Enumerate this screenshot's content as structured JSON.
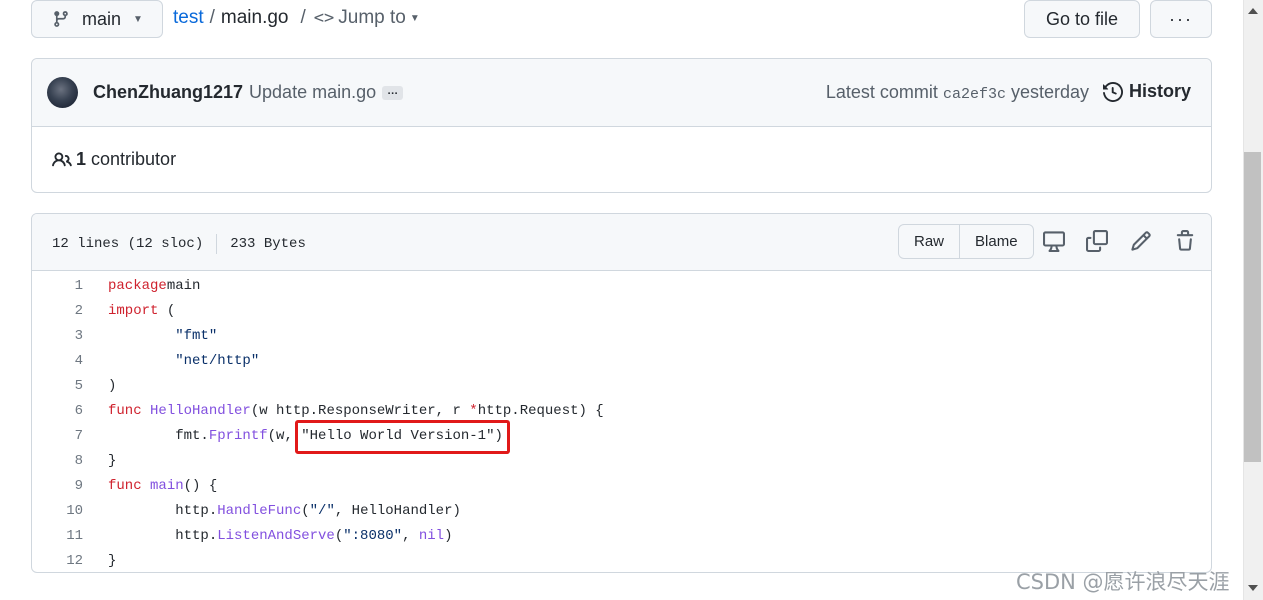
{
  "topbar": {
    "branch": "main",
    "repo": "test",
    "separator": "/",
    "file": "main.go",
    "jump_to": "Jump to",
    "goto_file": "Go to file",
    "more": "···"
  },
  "commit": {
    "author": "ChenZhuang1217",
    "message": "Update main.go",
    "ellipsis": "…",
    "latest_label": "Latest commit",
    "sha": "ca2ef3c",
    "time": "yesterday",
    "history": "History",
    "contributors_count": "1",
    "contributors_label": "contributor"
  },
  "file": {
    "lines_info": "12 lines (12 sloc)",
    "size": "233 Bytes",
    "raw": "Raw",
    "blame": "Blame",
    "code": [
      {
        "n": "1",
        "tokens": [
          [
            "kw",
            "package"
          ],
          [
            "",
            "main"
          ]
        ]
      },
      {
        "n": "2",
        "tokens": [
          [
            "kw",
            "import"
          ],
          [
            "",
            " ("
          ]
        ]
      },
      {
        "n": "3",
        "tokens": [
          [
            "",
            "        "
          ],
          [
            "str",
            "\"fmt\""
          ]
        ]
      },
      {
        "n": "4",
        "tokens": [
          [
            "",
            "        "
          ],
          [
            "str",
            "\"net/http\""
          ]
        ]
      },
      {
        "n": "5",
        "tokens": [
          [
            "",
            ")"
          ]
        ]
      },
      {
        "n": "6",
        "tokens": [
          [
            "kw",
            "func"
          ],
          [
            "",
            " "
          ],
          [
            "fn",
            "HelloHandler"
          ],
          [
            "",
            "(w http.ResponseWriter, r "
          ],
          [
            "kw",
            "*"
          ],
          [
            "",
            "http.Request) {"
          ]
        ]
      },
      {
        "n": "7",
        "tokens": [
          [
            "",
            "        fmt."
          ],
          [
            "fn",
            "Fprintf"
          ],
          [
            "",
            "(w, "
          ],
          [
            "hl",
            "\"Hello World Version-1\")"
          ]
        ]
      },
      {
        "n": "8",
        "tokens": [
          [
            "",
            "}"
          ]
        ]
      },
      {
        "n": "9",
        "tokens": [
          [
            "kw",
            "func"
          ],
          [
            "",
            " "
          ],
          [
            "fn",
            "main"
          ],
          [
            "",
            "() {"
          ]
        ]
      },
      {
        "n": "10",
        "tokens": [
          [
            "",
            "        http."
          ],
          [
            "fn",
            "HandleFunc"
          ],
          [
            "",
            "("
          ],
          [
            "str",
            "\"/\""
          ],
          [
            "",
            ", HelloHandler)"
          ]
        ]
      },
      {
        "n": "11",
        "tokens": [
          [
            "",
            "        http."
          ],
          [
            "fn",
            "ListenAndServe"
          ],
          [
            "",
            "("
          ],
          [
            "str",
            "\":8080\""
          ],
          [
            "",
            ", "
          ],
          [
            "fn",
            "nil"
          ],
          [
            "",
            ")"
          ]
        ]
      },
      {
        "n": "12",
        "tokens": [
          [
            "",
            "}"
          ]
        ]
      }
    ]
  },
  "watermark": "CSDN @愿许浪尽天涯",
  "colors": {
    "link": "#0969da",
    "keyword": "#cf222e",
    "function": "#8250df",
    "string": "#0a3069",
    "highlight_box": "#e11919"
  },
  "icons": [
    "git-branch-icon",
    "code-icon",
    "history-icon",
    "people-icon",
    "desktop-icon",
    "copy-icon",
    "pencil-icon",
    "trash-icon"
  ]
}
